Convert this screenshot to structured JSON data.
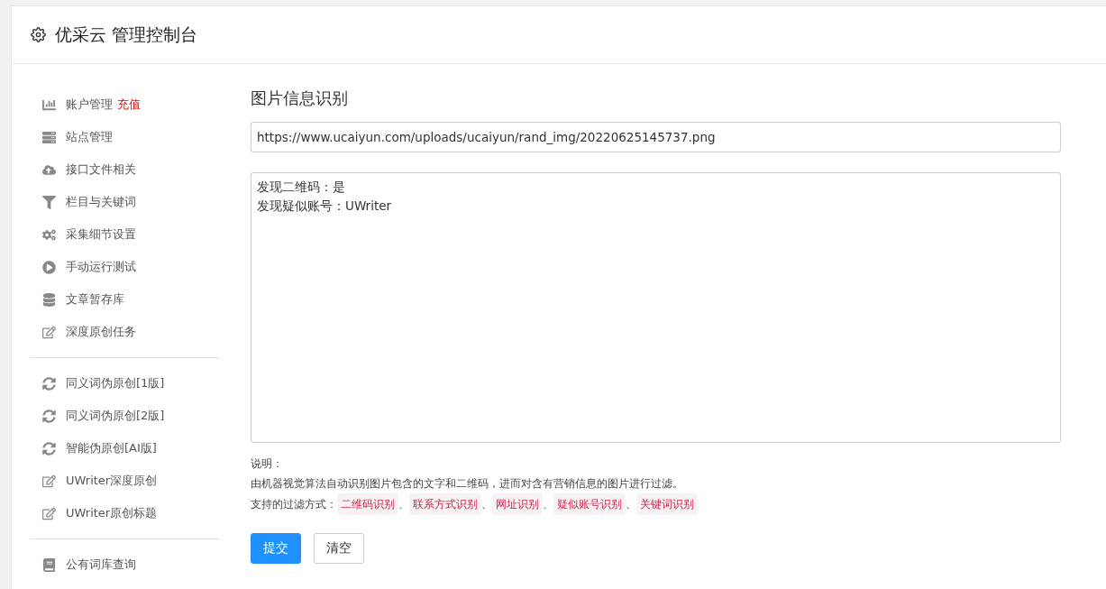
{
  "header": {
    "title": "优采云 管理控制台"
  },
  "sidebar": {
    "groups": [
      {
        "items": [
          {
            "label": "账户管理",
            "badge": "充值"
          },
          {
            "label": "站点管理"
          },
          {
            "label": "接口文件相关"
          },
          {
            "label": "栏目与关键词"
          },
          {
            "label": "采集细节设置"
          },
          {
            "label": "手动运行测试"
          },
          {
            "label": "文章暂存库"
          },
          {
            "label": "深度原创任务"
          }
        ]
      },
      {
        "items": [
          {
            "label": "同义词伪原创[1版]"
          },
          {
            "label": "同义词伪原创[2版]"
          },
          {
            "label": "智能伪原创[AI版]"
          },
          {
            "label": "UWriter深度原创"
          },
          {
            "label": "UWriter原创标题"
          }
        ]
      },
      {
        "items": [
          {
            "label": "公有词库查询"
          }
        ]
      }
    ]
  },
  "main": {
    "title": "图片信息识别",
    "url_field": {
      "value": "https://www.ucaiyun.com/uploads/ucaiyun/rand_img/20220625145737.png"
    },
    "result_lines": [
      "发现二维码：是",
      "发现疑似账号：UWriter"
    ],
    "note_label": "说明：",
    "note_text": "由机器视觉算法自动识别图片包含的文字和二维码，进而对含有营销信息的图片进行过滤。",
    "filters_label": "支持的过滤方式：",
    "separator": "、",
    "filters": [
      "二维码识别",
      "联系方式识别",
      "网址识别",
      "疑似账号识别",
      "关键词识别"
    ],
    "buttons": [
      {
        "kind": "primary",
        "label": "提交"
      },
      {
        "kind": "default",
        "label": "清空"
      }
    ]
  }
}
